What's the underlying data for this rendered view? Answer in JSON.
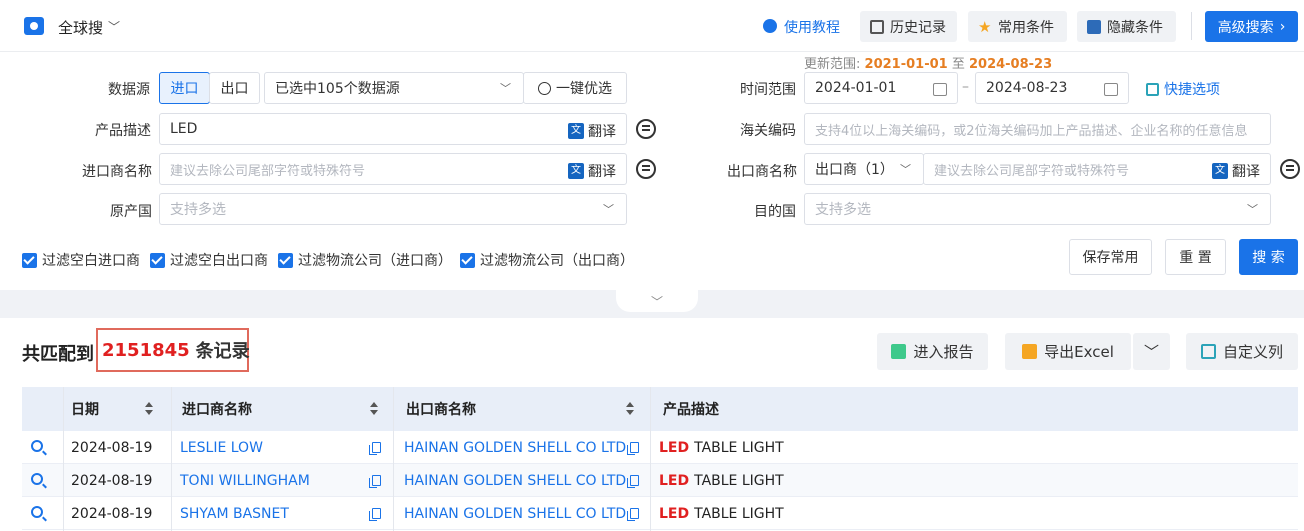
{
  "topbar": {
    "brand": "全球搜",
    "tutorial": "使用教程",
    "history": "历史记录",
    "common_conditions": "常用条件",
    "hide_conditions": "隐藏条件",
    "advanced_search": "高级搜索",
    "colors": {
      "accent": "#1a73e8"
    }
  },
  "form": {
    "data_source_label": "数据源",
    "import_tab": "进口",
    "export_tab": "出口",
    "selected_sources": "已选中105个数据源",
    "one_key_optimize": "一键优选",
    "update_range_prefix": "更新范围:",
    "update_start": "2021-01-01",
    "update_to": "至",
    "update_end": "2024-08-23",
    "time_range_label": "时间范围",
    "date_start": "2024-01-01",
    "date_end": "2024-08-23",
    "quick_options": "快捷选项",
    "product_desc_label": "产品描述",
    "product_desc_value": "LED",
    "translate": "翻译",
    "hs_code_label": "海关编码",
    "hs_code_placeholder": "支持4位以上海关编码，或2位海关编码加上产品描述、企业名称的任意信息",
    "importer_label": "进口商名称",
    "importer_placeholder": "建议去除公司尾部字符或特殊符号",
    "exporter_label": "出口商名称",
    "exporter_select": "出口商（1）",
    "exporter_placeholder": "建议去除公司尾部字符或特殊符号",
    "origin_label": "原产国",
    "origin_placeholder": "支持多选",
    "dest_label": "目的国",
    "dest_placeholder": "支持多选",
    "filters": [
      "过滤空白进口商",
      "过滤空白出口商",
      "过滤物流公司（进口商）",
      "过滤物流公司（出口商）"
    ],
    "save_common": "保存常用",
    "reset": "重 置",
    "search": "搜 索"
  },
  "results": {
    "prefix": "共匹配到",
    "count": "2151845",
    "suffix": "条记录",
    "report_btn": "进入报告",
    "excel_btn": "导出Excel",
    "custom_cols_btn": "自定义列",
    "columns": [
      "日期",
      "进口商名称",
      "出口商名称",
      "产品描述"
    ],
    "rows": [
      {
        "date": "2024-08-19",
        "importer": "LESLIE LOW",
        "exporter": "HAINAN GOLDEN SHELL CO LTD",
        "kw": "LED",
        "desc": "TABLE LIGHT"
      },
      {
        "date": "2024-08-19",
        "importer": "TONI WILLINGHAM",
        "exporter": "HAINAN GOLDEN SHELL CO LTD",
        "kw": "LED",
        "desc": "TABLE LIGHT"
      },
      {
        "date": "2024-08-19",
        "importer": "SHYAM BASNET",
        "exporter": "HAINAN GOLDEN SHELL CO LTD",
        "kw": "LED",
        "desc": "TABLE LIGHT"
      }
    ]
  }
}
